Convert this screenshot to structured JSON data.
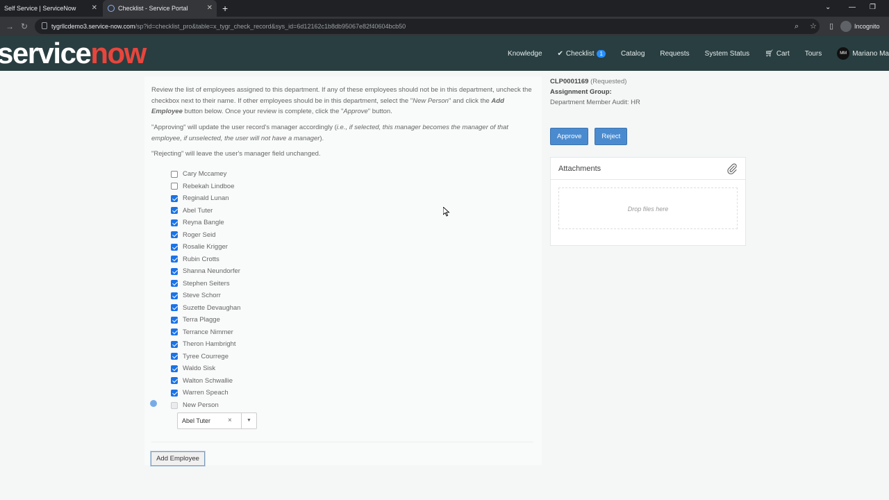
{
  "browser": {
    "tabs": [
      {
        "title": "Self Service | ServiceNow",
        "active": false
      },
      {
        "title": "Checklist - Service Portal",
        "active": true
      }
    ],
    "url_domain": "tygrllcdemo3.service-now.com",
    "url_path": "/sp?id=checklist_pro&table=x_tygr_check_record&sys_id=6d12162c1b8db95067e82f40604bcb50",
    "profile": "Incognito"
  },
  "header": {
    "logo_left": "service",
    "logo_right": "now",
    "nav": {
      "knowledge": "Knowledge",
      "checklist": "Checklist",
      "checklist_count": "1",
      "catalog": "Catalog",
      "requests": "Requests",
      "system_status": "System Status",
      "cart": "Cart",
      "tours": "Tours",
      "user_initials": "MM",
      "user_name": "Mariano Ma"
    }
  },
  "instructions": {
    "p1_a": "Review the list of employees assigned to this department. If any of these employees should not be in this department, uncheck the checkbox next to their name. If other employees should be in this department, select the \"",
    "p1_new_person": "New Person",
    "p1_b": "\" and click the ",
    "p1_add_employee": "Add Employee",
    "p1_c": " button below. Once your review is complete, click the \"",
    "p1_approve": "Approve",
    "p1_d": "\" button.",
    "p2_a": "\"Approving\" will update the user record's manager accordingly (",
    "p2_italic": "i.e., if selected, this manager becomes the manager of that employee, if unselected, the user will not have a manager",
    "p2_b": ").",
    "p3": "\"Rejecting\" will leave the user's manager field unchanged."
  },
  "employees": [
    {
      "name": "Cary Mccamey",
      "checked": false
    },
    {
      "name": "Rebekah Lindboe",
      "checked": false
    },
    {
      "name": "Reginald Lunan",
      "checked": true
    },
    {
      "name": "Abel Tuter",
      "checked": true
    },
    {
      "name": "Reyna Bangle",
      "checked": true
    },
    {
      "name": "Roger Seid",
      "checked": true
    },
    {
      "name": "Rosalie Krigger",
      "checked": true
    },
    {
      "name": "Rubin Crotts",
      "checked": true
    },
    {
      "name": "Shanna Neundorfer",
      "checked": true
    },
    {
      "name": "Stephen Seiters",
      "checked": true
    },
    {
      "name": "Steve Schorr",
      "checked": true
    },
    {
      "name": "Suzette Devaughan",
      "checked": true
    },
    {
      "name": "Terra Plagge",
      "checked": true
    },
    {
      "name": "Terrance Nimmer",
      "checked": true
    },
    {
      "name": "Theron Hambright",
      "checked": true
    },
    {
      "name": "Tyree Courrege",
      "checked": true
    },
    {
      "name": "Waldo Sisk",
      "checked": true
    },
    {
      "name": "Walton Schwallie",
      "checked": true
    },
    {
      "name": "Warren Speach",
      "checked": true
    }
  ],
  "new_person": {
    "label": "New Person",
    "selected": "Abel Tuter",
    "clear": "×",
    "arrow": "▼"
  },
  "add_employee_label": "Add Employee",
  "record": {
    "number": "CLP0001169",
    "state": "(Requested)",
    "assignment_group_label": "Assignment Group:",
    "assignment_group_value": "Department Member Audit: HR"
  },
  "actions": {
    "approve": "Approve",
    "reject": "Reject"
  },
  "attachments": {
    "title": "Attachments",
    "drop_text": "Drop files here"
  }
}
